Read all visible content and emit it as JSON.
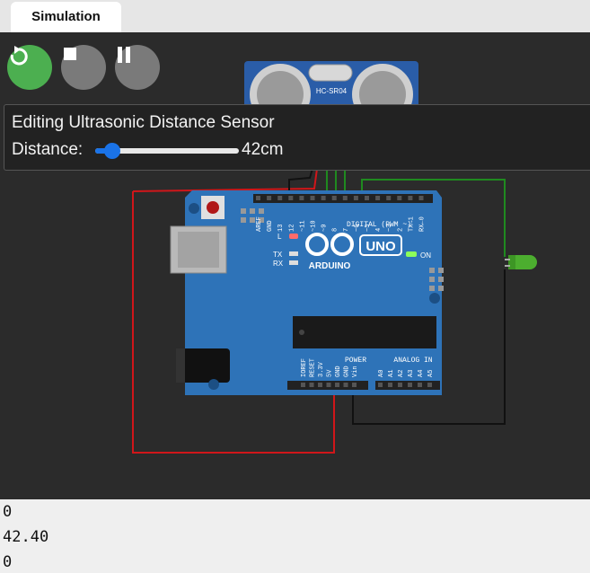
{
  "tabs": {
    "active_label": "Simulation"
  },
  "controls": {
    "restart": "restart-icon",
    "stop": "stop-icon",
    "pause": "pause-icon"
  },
  "sensor": {
    "model": "HC-SR04"
  },
  "editor": {
    "title": "Editing Ultrasonic Distance Sensor",
    "distance_label": "Distance:",
    "distance_value": "42cm",
    "slider_level": 0.12
  },
  "board": {
    "brand": "ARDUINO",
    "model": "UNO",
    "on_label": "ON",
    "l_label": "L",
    "tx_label": "TX",
    "rx_label": "RX",
    "digital_label": "DIGITAL (PWM ~)",
    "analog_label": "ANALOG IN",
    "power_label": "POWER",
    "digital_pins": [
      "AREF",
      "GND",
      "13",
      "12",
      "~11",
      "~10",
      "~9",
      "8",
      "7",
      "~6",
      "~5",
      "4",
      "~3",
      "2",
      "TX→1",
      "RX←0"
    ],
    "power_pins": [
      "IOREF",
      "RESET",
      "3.3V",
      "5V",
      "GND",
      "GND",
      "Vin"
    ],
    "analog_pins": [
      "A0",
      "A1",
      "A2",
      "A3",
      "A4",
      "A5"
    ]
  },
  "colors": {
    "board": "#2e73b8",
    "accent_green": "#4caf50",
    "wire_red": "#d0161a",
    "wire_green": "#1f8a1f",
    "wire_black": "#111111",
    "slider": "#1a73e8",
    "led_green": "#4cae2f"
  },
  "serial": {
    "lines": [
      "0",
      "42.40",
      "0"
    ]
  }
}
